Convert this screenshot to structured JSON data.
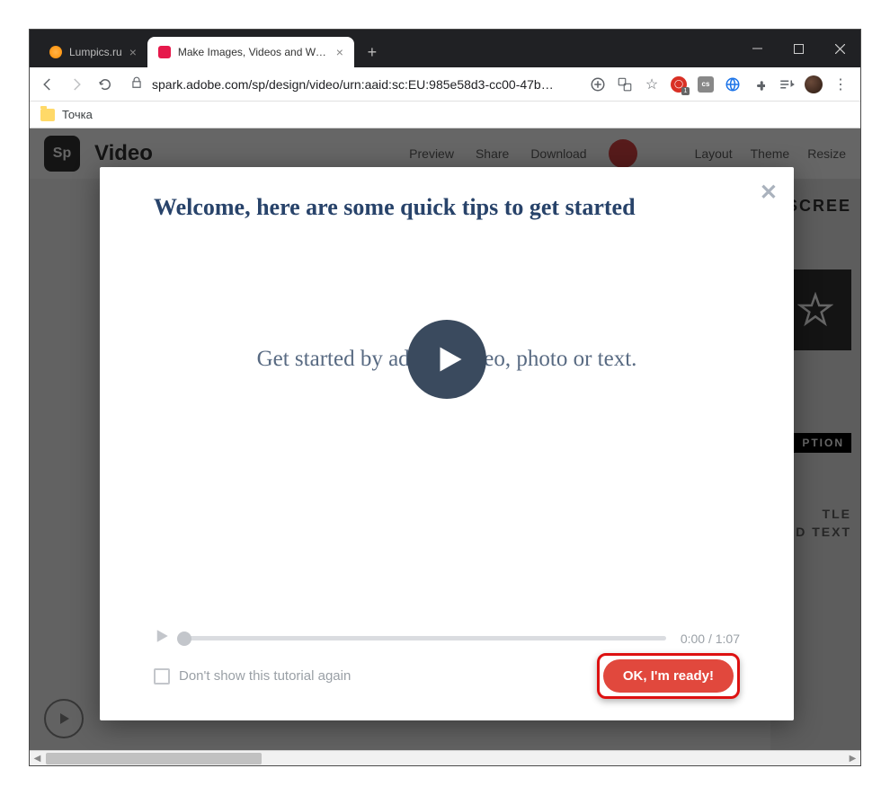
{
  "window": {
    "tabs": [
      {
        "title": "Lumpics.ru",
        "active": false
      },
      {
        "title": "Make Images, Videos and Web S",
        "active": true
      }
    ]
  },
  "browser": {
    "url": "spark.adobe.com/sp/design/video/urn:aaid:sc:EU:985e58d3-cc00-47b…",
    "bookmark": "Точка",
    "ext_badge": "1",
    "ext_cs": "cs"
  },
  "app": {
    "logo": "Sp",
    "title": "Video",
    "actions": {
      "preview": "Preview",
      "share": "Share",
      "download": "Download"
    },
    "tabs": {
      "layout": "Layout",
      "theme": "Theme",
      "resize": "Resize"
    },
    "panel": {
      "screen": "SCREE",
      "ption": "PTION",
      "tle": "TLE",
      "dtext": "D TEXT"
    }
  },
  "modal": {
    "title": "Welcome, here are some quick tips to get started",
    "center": "Get started by adding video, photo or text.",
    "time": "0:00 / 1:07",
    "check_label": "Don't show this tutorial again",
    "ready": "OK, I'm ready!"
  }
}
